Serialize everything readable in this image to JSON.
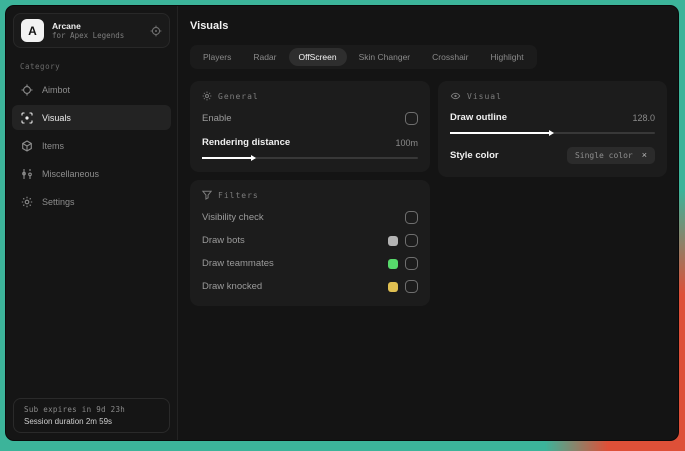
{
  "backdrop": {
    "teal": "#3cb49a",
    "red": "#de5038"
  },
  "sidebar": {
    "app": {
      "initial": "A",
      "name": "Arcane",
      "subtitle": "for Apex Legends"
    },
    "category_label": "Category",
    "items": [
      {
        "label": "Aimbot",
        "icon": "crosshair-icon",
        "active": false
      },
      {
        "label": "Visuals",
        "icon": "eye-scan-icon",
        "active": true
      },
      {
        "label": "Items",
        "icon": "cube-icon",
        "active": false
      },
      {
        "label": "Miscellaneous",
        "icon": "sliders-icon",
        "active": false
      },
      {
        "label": "Settings",
        "icon": "gear-icon",
        "active": false
      }
    ],
    "session": {
      "line1": "Sub expires in 9d 23h",
      "line2": "Session duration 2m 59s"
    }
  },
  "main": {
    "title": "Visuals",
    "tabs": [
      {
        "label": "Players",
        "active": false
      },
      {
        "label": "Radar",
        "active": false
      },
      {
        "label": "OffScreen",
        "active": true
      },
      {
        "label": "Skin Changer",
        "active": false
      },
      {
        "label": "Crosshair",
        "active": false
      },
      {
        "label": "Highlight",
        "active": false
      }
    ],
    "panels": {
      "general": {
        "title": "General",
        "enable_label": "Enable",
        "enable_checked": false,
        "slider_label": "Rendering distance",
        "slider_value": "100m",
        "slider_percent": "23%"
      },
      "filters": {
        "title": "Filters",
        "rows": [
          {
            "label": "Visibility check",
            "swatch": null,
            "checked": false
          },
          {
            "label": "Draw bots",
            "swatch": "#b3b3b3",
            "checked": false
          },
          {
            "label": "Draw teammates",
            "swatch": "#57d96b",
            "checked": false
          },
          {
            "label": "Draw knocked",
            "swatch": "#e0c052",
            "checked": false
          }
        ]
      },
      "visual": {
        "title": "Visual",
        "slider_label": "Draw outline",
        "slider_value": "128.0",
        "slider_percent": "49%",
        "style_label": "Style color",
        "chip_label": "Single color",
        "chip_close": "×"
      }
    }
  }
}
